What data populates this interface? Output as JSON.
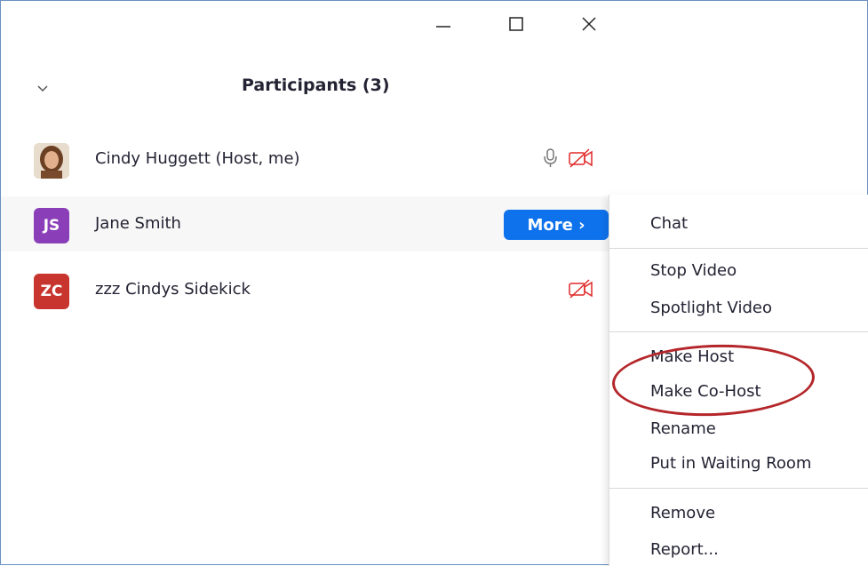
{
  "window_controls": {
    "minimize_icon": "minimize-icon",
    "maximize_icon": "maximize-icon",
    "close_icon": "close-icon"
  },
  "panel": {
    "title": "Participants (3)",
    "collapse_icon": "chevron-down-icon"
  },
  "participants": [
    {
      "name": "Cindy Huggett (Host, me)",
      "initials": "",
      "avatar": "photo",
      "mic": "unmuted",
      "video": "off"
    },
    {
      "name": "Jane Smith",
      "initials": "JS",
      "avatar_color": "#8a3fb8",
      "action": "More ›"
    },
    {
      "name": "zzz Cindys Sidekick",
      "initials": "ZC",
      "avatar_color": "#c8352f",
      "video": "off"
    }
  ],
  "more_button": {
    "label": "More ›",
    "color": "#0e72ed"
  },
  "context_menu": {
    "items": [
      "Chat",
      "Stop Video",
      "Spotlight Video",
      "Make Host",
      "Make Co-Host",
      "Rename",
      "Put in Waiting Room",
      "Remove",
      "Report..."
    ]
  },
  "annotation": {
    "type": "ellipse",
    "color": "#b4262a",
    "highlights": "Make Co-Host"
  }
}
